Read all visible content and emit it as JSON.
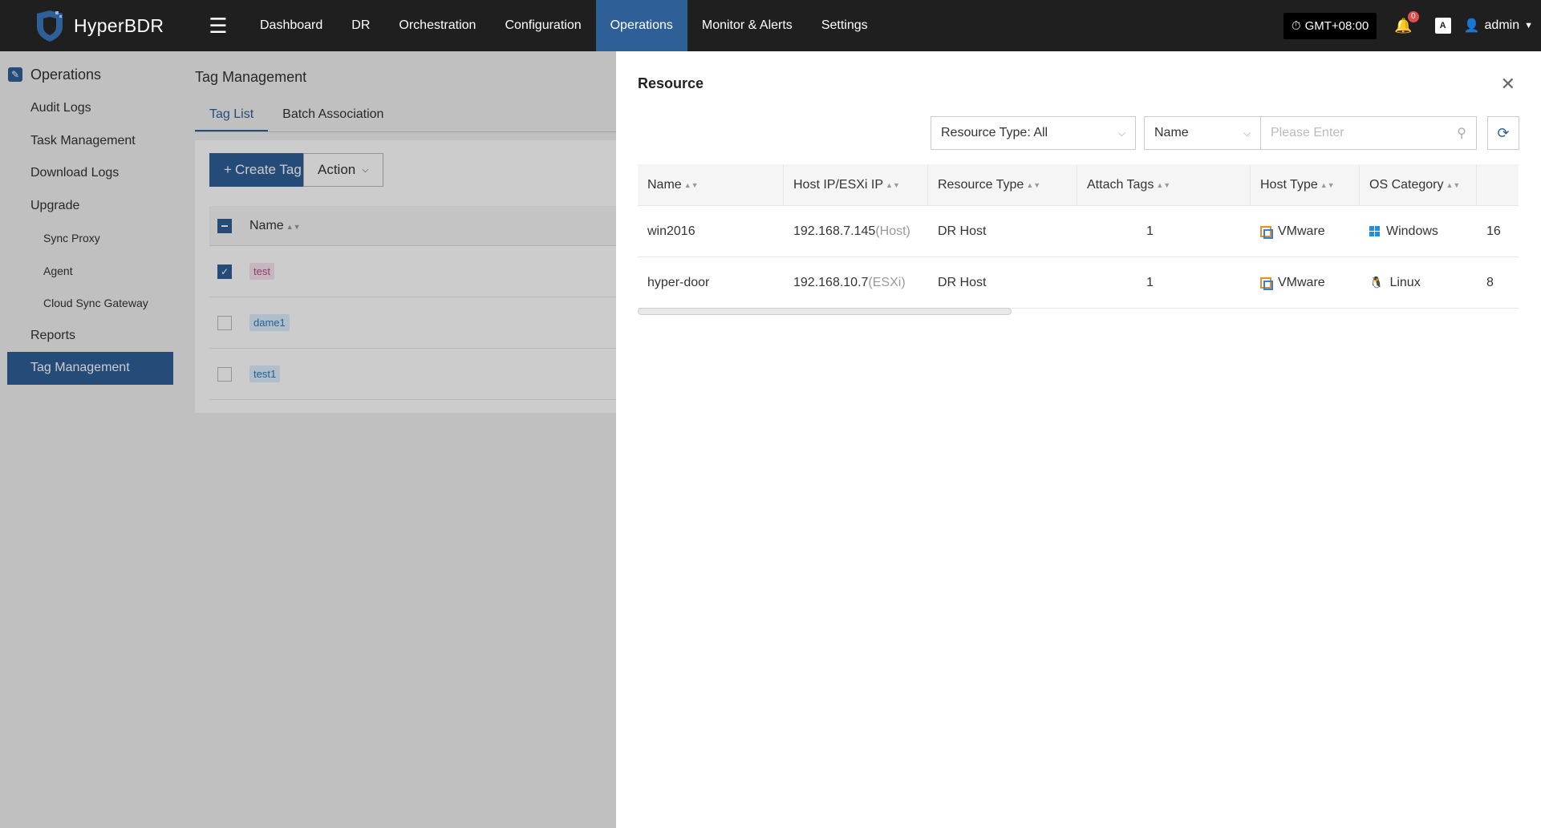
{
  "app": {
    "name": "HyperBDR"
  },
  "nav": {
    "items": [
      "Dashboard",
      "DR",
      "Orchestration",
      "Configuration",
      "Operations",
      "Monitor & Alerts",
      "Settings"
    ],
    "active": "Operations"
  },
  "topright": {
    "timezone": "GMT+08:00",
    "alert_count": "0",
    "lang_label": "A",
    "user": "admin"
  },
  "sidebar": {
    "header": "Operations",
    "items": {
      "audit": "Audit Logs",
      "task": "Task Management",
      "download": "Download Logs",
      "upgrade": "Upgrade",
      "sync_proxy": "Sync Proxy",
      "agent": "Agent",
      "cloud_sync": "Cloud Sync Gateway",
      "reports": "Reports",
      "tag_mgmt": "Tag Management"
    }
  },
  "main": {
    "title": "Tag Management",
    "tabs": [
      "Tag List",
      "Batch Association"
    ],
    "create_label": "Create Tag",
    "action_label": "Action",
    "name_header": "Name",
    "tags": [
      "test",
      "dame1",
      "test1"
    ]
  },
  "drawer": {
    "title": "Resource",
    "resource_type": "Resource Type: All",
    "field_select": "Name",
    "search_placeholder": "Please Enter",
    "columns": [
      "Name",
      "Host IP/ESXi IP",
      "Resource Type",
      "Attach Tags",
      "Host Type",
      "OS Category"
    ],
    "rows": [
      {
        "name": "win2016",
        "ip": "192.168.7.145",
        "ip_kind": "(Host)",
        "type": "DR Host",
        "tags": "1",
        "host_type": "VMware",
        "os": "Windows",
        "extra": "16"
      },
      {
        "name": "hyper-door",
        "ip": "192.168.10.7",
        "ip_kind": "(ESXi)",
        "type": "DR Host",
        "tags": "1",
        "host_type": "VMware",
        "os": "Linux",
        "extra": "8"
      }
    ]
  },
  "colors": {
    "primary": "#2f5f97",
    "topbar": "#1f1f1f",
    "vmware_orange": "#f08a24",
    "windows_blue": "#1e8fe1"
  }
}
